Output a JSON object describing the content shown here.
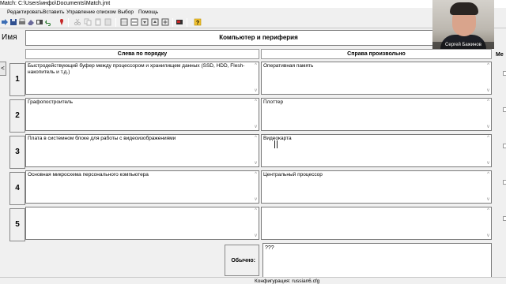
{
  "window": {
    "title": "Match: C:\\Users\\инфо\\Documents\\Match.jmt"
  },
  "menu": [
    "Редактировать",
    "Вставить",
    "Управление списком",
    "Выбор",
    "Помощь"
  ],
  "toolbar": {
    "icons": [
      "arrow-right-icon",
      "save-icon",
      "print-icon",
      "erase-icon",
      "toggle-icon",
      "undo-icon",
      "pin-icon",
      "cut-icon",
      "copy-icon",
      "paste-icon",
      "paste-special-icon",
      "insert-row-icon",
      "delete-row-icon",
      "move-down-icon",
      "move-up-icon",
      "add-icon",
      "image-icon",
      "help-icon"
    ]
  },
  "name_label": "Имя",
  "name_value": "Компьютер и периферия",
  "headers": {
    "left": "Слева по порядку",
    "right": "Справа произвольно",
    "extra": "Ме"
  },
  "rows": [
    {
      "num": "1",
      "left": "Быстродействующий буфер между процессором и хранилищем данных (SSD, HDD, Flesh-накопитель и т.д.)",
      "right": "Оперативная память"
    },
    {
      "num": "2",
      "left": "Графопостроитель",
      "right": "Плоттер"
    },
    {
      "num": "3",
      "left": "Плата в системном блоке для работы с видеоизображениями",
      "right": "Видеокарта"
    },
    {
      "num": "4",
      "left": "Основная микросхема персонального компьютера",
      "right": "Центральный процессор"
    },
    {
      "num": "5",
      "left": "",
      "right": ""
    }
  ],
  "bottom": {
    "label": "Обычно:",
    "value": "???"
  },
  "status": "Конфигурация: russian6.cfg",
  "webcam": {
    "caption": "Сергей Бажинов"
  },
  "side_button": "<"
}
